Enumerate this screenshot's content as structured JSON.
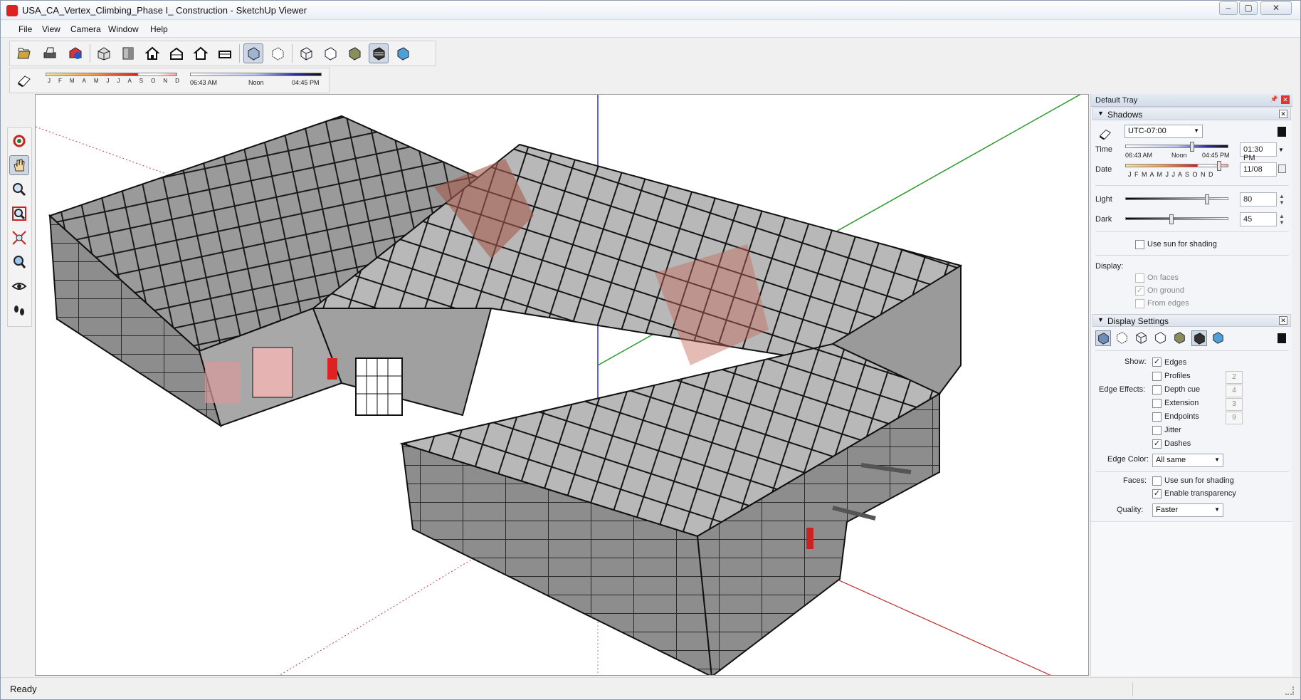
{
  "window": {
    "title": "USA_CA_Vertex_Climbing_Phase I_ Construction - SketchUp Viewer",
    "min": "–",
    "max": "▢",
    "close": "✕"
  },
  "menu": [
    "File",
    "View",
    "Camera",
    "Window",
    "Help"
  ],
  "toolbar": {
    "months": [
      "J",
      "F",
      "M",
      "A",
      "M",
      "J",
      "J",
      "A",
      "S",
      "O",
      "N",
      "D"
    ],
    "time_start": "06:43 AM",
    "time_noon": "Noon",
    "time_end": "04:45 PM",
    "icons": [
      "open-icon",
      "print-icon",
      "model-info-icon",
      "iso-view-icon",
      "top-view-icon",
      "front-view-icon",
      "right-view-icon",
      "back-view-icon",
      "left-view-icon",
      "xray-icon",
      "back-edges-icon",
      "wireframe-icon",
      "hidden-line-icon",
      "shaded-icon",
      "shaded-textures-icon",
      "monochrome-icon"
    ]
  },
  "left_tools": [
    "orbit-icon",
    "pan-icon",
    "zoom-icon",
    "zoom-window-icon",
    "zoom-extents-icon",
    "previous-view-icon",
    "look-around-icon",
    "walk-icon"
  ],
  "status": "Ready",
  "tray": {
    "title": "Default Tray",
    "shadows": {
      "header": "Shadows",
      "timezone": "UTC-07:00",
      "time_label": "Time",
      "date_label": "Date",
      "time_value": "01:30 PM",
      "date_value": "11/08",
      "time_start": "06:43 AM",
      "time_noon": "Noon",
      "time_end": "04:45 PM",
      "months": "J F M A M J J A S O N D",
      "light_label": "Light",
      "light_value": "80",
      "light_level": 0.8,
      "dark_label": "Dark",
      "dark_value": "45",
      "dark_level": 0.45,
      "use_sun": "Use sun for shading",
      "display_label": "Display:",
      "on_faces": "On faces",
      "on_ground": "On ground",
      "from_edges": "From edges"
    },
    "display_settings": {
      "header": "Display Settings",
      "show_label": "Show:",
      "edge_effects_label": "Edge Effects:",
      "edges": "Edges",
      "profiles": "Profiles",
      "depth_cue": "Depth cue",
      "extension": "Extension",
      "endpoints": "Endpoints",
      "jitter": "Jitter",
      "dashes": "Dashes",
      "profiles_val": "2",
      "depth_val": "4",
      "extension_val": "3",
      "endpoints_val": "9",
      "edge_color_label": "Edge Color:",
      "edge_color": "All same",
      "faces_label": "Faces:",
      "faces_use_sun": "Use sun for shading",
      "transparency": "Enable transparency",
      "quality_label": "Quality:",
      "quality": "Faster"
    }
  }
}
